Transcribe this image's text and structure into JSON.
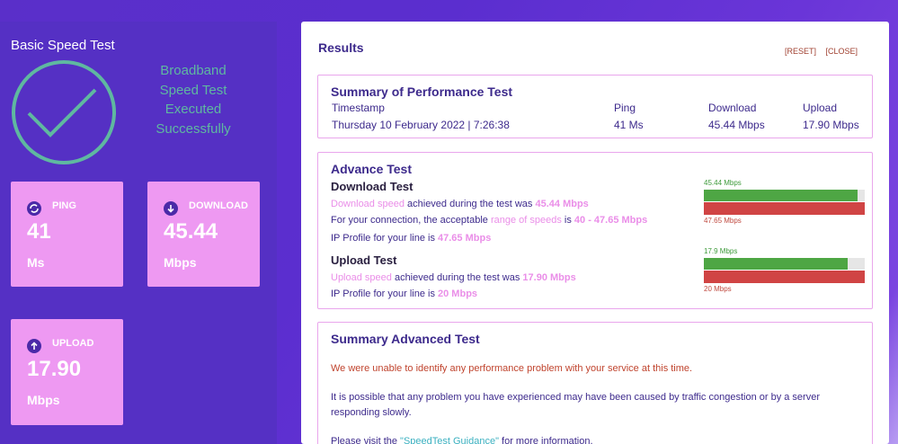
{
  "left": {
    "title": "Basic Speed Test",
    "success_lines": [
      "Broadband",
      "Speed Test",
      "Executed",
      "Successfully"
    ],
    "cards": {
      "ping": {
        "label": "PING",
        "value": "41",
        "unit": "Ms",
        "icon": "ping-icon"
      },
      "download": {
        "label": "DOWNLOAD",
        "value": "45.44",
        "unit": "Mbps",
        "icon": "download-arrow-icon"
      },
      "upload": {
        "label": "UPLOAD",
        "value": "17.90",
        "unit": "Mbps",
        "icon": "upload-arrow-icon"
      }
    }
  },
  "results": {
    "title": "Results",
    "reset": "[RESET]",
    "close": "[CLOSE]",
    "summary": {
      "title": "Summary of Performance Test",
      "timestamp_label": "Timestamp",
      "timestamp_value": "Thursday 10 February 2022 | 7:26:38",
      "ping_label": "Ping",
      "ping_value": "41 Ms",
      "download_label": "Download",
      "download_value": "45.44 Mbps",
      "upload_label": "Upload",
      "upload_value": "17.90 Mbps"
    },
    "advance": {
      "title": "Advance Test",
      "download": {
        "title": "Download Test",
        "l1_a": "Download speed",
        "l1_b": " achieved during the test was ",
        "l1_c": "45.44 Mbps",
        "l2_a": "For your connection, the acceptable ",
        "l2_b": "range of speeds",
        "l2_c": " is ",
        "l2_d": "40 - 47.65 Mbps",
        "l3_a": "IP Profile for your line is ",
        "l3_b": "47.65 Mbps",
        "bar_top": "45.44 Mbps",
        "bar_bottom": "47.65 Mbps",
        "bar_fraction": 0.954
      },
      "upload": {
        "title": "Upload Test",
        "l1_a": "Upload speed",
        "l1_b": " achieved during the test was ",
        "l1_c": "17.90 Mbps",
        "l2_a": "IP Profile for your line is ",
        "l2_b": "20 Mbps",
        "bar_top": "17.9 Mbps",
        "bar_bottom": "20 Mbps",
        "bar_fraction": 0.895
      }
    },
    "adv_summary": {
      "title": "Summary Advanced Test",
      "p1": "We were unable to identify any performance problem with your service at this time.",
      "p2": "It is possible that any problem you have experienced may have been caused by traffic congestion or by a server responding slowly.",
      "p3_a": "Please visit the ",
      "p3_link": "\"SpeedTest Guidance\"",
      "p3_b": " for more information."
    }
  },
  "colors": {
    "background": "#5a2fc9",
    "card": "#ee99f2",
    "success": "#5fb8a0",
    "green_bar": "#4ea644",
    "red_bar": "#d04444",
    "heading": "#3d2a8c"
  }
}
